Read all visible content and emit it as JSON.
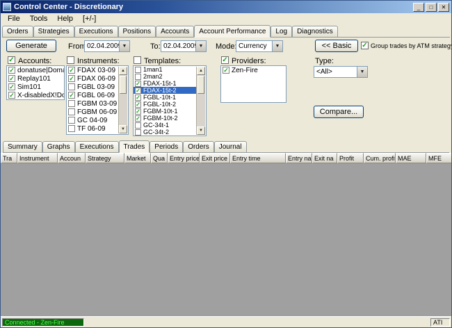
{
  "window": {
    "title": "Control Center - Discretionary",
    "controls": {
      "minimize": "_",
      "maximize": "□",
      "close": "✕"
    }
  },
  "icons": {
    "dropdown": "▼",
    "scroll_up": "▲",
    "scroll_down": "▼"
  },
  "menubar": {
    "items": [
      "File",
      "Tools",
      "Help",
      "[+/-]"
    ]
  },
  "main_tabs": {
    "items": [
      "Orders",
      "Strategies",
      "Executions",
      "Positions",
      "Accounts",
      "Account Performance",
      "Log",
      "Diagnostics"
    ],
    "selected_index": 5
  },
  "toolbar": {
    "generate": "Generate",
    "from_label": "From:",
    "from_value": "02.04.2009",
    "to_label": "To:",
    "to_value": "02.04.2009",
    "mode_label": "Mode:",
    "mode_value": "Currency",
    "basic": "<< Basic",
    "group_checkbox": {
      "label": "Group trades by ATM strategy",
      "checked": true
    }
  },
  "filters": {
    "accounts": {
      "label": "Accounts:",
      "checked": true,
      "items": [
        {
          "label": "donatuse|Domar",
          "checked": true
        },
        {
          "label": "Replay101",
          "checked": true
        },
        {
          "label": "Sim101",
          "checked": true
        },
        {
          "label": "X-disabledX!Dom",
          "checked": true
        }
      ]
    },
    "instruments": {
      "label": "Instruments:",
      "checked": false,
      "items": [
        {
          "label": "FDAX 03-09",
          "checked": true
        },
        {
          "label": "FDAX 06-09",
          "checked": true
        },
        {
          "label": "FGBL 03-09",
          "checked": false
        },
        {
          "label": "FGBL 06-09",
          "checked": true
        },
        {
          "label": "FGBM 03-09",
          "checked": false
        },
        {
          "label": "FGBM 06-09",
          "checked": false
        },
        {
          "label": "GC 04-09",
          "checked": false
        },
        {
          "label": "TF 06-09",
          "checked": false
        }
      ]
    },
    "templates": {
      "label": "Templates:",
      "checked": false,
      "items": [
        {
          "label": "1man1",
          "checked": false
        },
        {
          "label": "2man2",
          "checked": false
        },
        {
          "label": "FDAX-15t-1",
          "checked": true
        },
        {
          "label": "FDAX-15t-2",
          "checked": true,
          "selected": true
        },
        {
          "label": "FGBL-10t-1",
          "checked": true
        },
        {
          "label": "FGBL-10t-2",
          "checked": true
        },
        {
          "label": "FGBM-10t-1",
          "checked": true
        },
        {
          "label": "FGBM-10t-2",
          "checked": true
        },
        {
          "label": "GC-34t-1",
          "checked": false
        },
        {
          "label": "GC-34t-2",
          "checked": false
        }
      ]
    },
    "providers": {
      "label": "Providers:",
      "checked": true,
      "items": [
        {
          "label": "Zen-Fire",
          "checked": true
        }
      ]
    },
    "type": {
      "label": "Type:",
      "value": "<All>"
    },
    "compare": "Compare..."
  },
  "sub_tabs": {
    "items": [
      "Summary",
      "Graphs",
      "Executions",
      "Trades",
      "Periods",
      "Orders",
      "Journal"
    ],
    "selected_index": 3
  },
  "trades_table": {
    "columns": [
      "Tra",
      "Instrument",
      "Accoun",
      "Strategy",
      "Market",
      "Qua",
      "Entry price",
      "Exit price",
      "Entry time",
      "Entry na",
      "Exit na",
      "Profit",
      "Cum. profit",
      "MAE",
      "MFE"
    ]
  },
  "statusbar": {
    "connection": "Connected - Zen-Fire",
    "right": "ATI"
  }
}
